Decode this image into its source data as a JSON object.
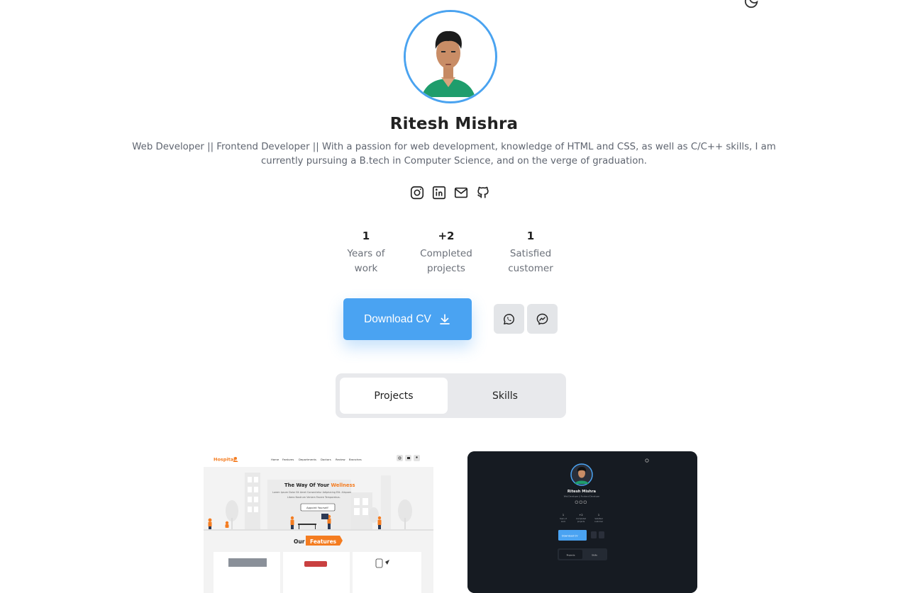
{
  "profile": {
    "name": "Ritesh Mishra",
    "bio": "Web Developer || Frontend Developer || With a passion for web development, knowledge of HTML and CSS, as well as C/C++ skills, I am currently pursuing a B.tech in Computer Science, and on the verge of graduation."
  },
  "socials": [
    "instagram-icon",
    "linkedin-icon",
    "mail-icon",
    "github-icon"
  ],
  "stats": [
    {
      "value": "1",
      "label": "Years of work"
    },
    {
      "value": "+2",
      "label": "Completed projects"
    },
    {
      "value": "1",
      "label": "Satisfied customer"
    }
  ],
  "actions": {
    "download_label": "Download CV",
    "whatsapp_icon": "whatsapp-icon",
    "messenger_icon": "messenger-icon"
  },
  "tabs": {
    "projects": "Projects",
    "skills": "Skills",
    "active": "Projects"
  },
  "colors": {
    "accent": "#4aa3f2",
    "tab_bg": "#e8e9ec",
    "dark_card": "#161b22",
    "hospital_orange": "#f47c20"
  },
  "projects": [
    {
      "brand": "Hospital",
      "nav": [
        "Home",
        "Features",
        "Departments",
        "Doctors",
        "Review",
        "Branches"
      ],
      "headline": "The Way Of Your",
      "headline_accent": "Wellness",
      "subtext_1": "Lorem Ipsum Dolor Sit Amet Consectetur Adipisicing Elit. Aliquam",
      "subtext_2": "Libero Nostrum Veniam Facere Temporebus.",
      "cta": "Appoint Yourself",
      "section_prefix": "Our",
      "section_accent": "Features"
    },
    {
      "name": "Ritesh Mishra",
      "subtitle": "Web Developer || Frontend Developer",
      "stats": [
        {
          "value": "1",
          "label_1": "Years of",
          "label_2": "work"
        },
        {
          "value": "+2",
          "label_1": "Completed",
          "label_2": "projects"
        },
        {
          "value": "1",
          "label_1": "Satisfied",
          "label_2": "customer"
        }
      ],
      "download_label": "Download CV",
      "tab_projects": "Projects",
      "tab_skills": "Skills"
    }
  ]
}
